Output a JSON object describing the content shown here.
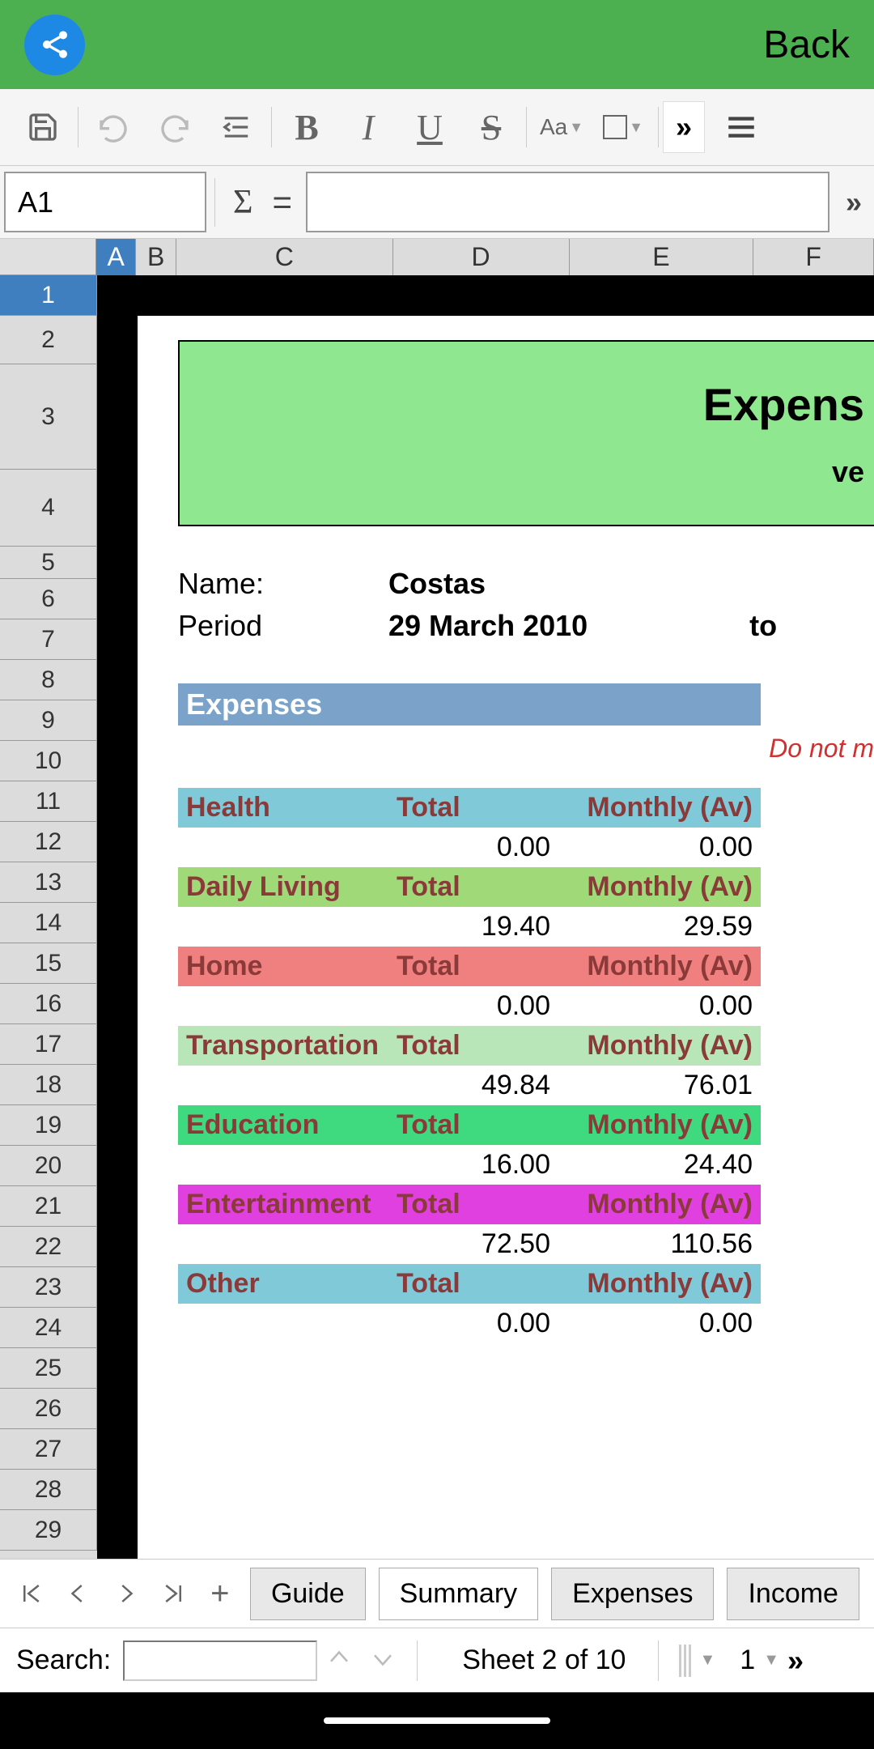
{
  "header": {
    "back_label": "Back"
  },
  "toolbar": {
    "bold": "B",
    "italic": "I",
    "underline": "U",
    "strike": "S",
    "aa": "Aa",
    "more": "»"
  },
  "formula_bar": {
    "cell_ref": "A1",
    "sigma": "Σ",
    "equals": "=",
    "more": "»"
  },
  "columns": [
    "A",
    "B",
    "C",
    "D",
    "E",
    "F"
  ],
  "rows": [
    "1",
    "2",
    "3",
    "4",
    "5",
    "6",
    "7",
    "8",
    "9",
    "10",
    "11",
    "12",
    "13",
    "14",
    "15",
    "16",
    "17",
    "18",
    "19",
    "20",
    "21",
    "22",
    "23",
    "24",
    "25",
    "26",
    "27",
    "28",
    "29"
  ],
  "doc": {
    "title_main": "Expens",
    "title_sub": "ve",
    "name_label": "Name:",
    "name_value": "Costas",
    "period_label": "Period",
    "period_value": "29 March 2010",
    "to_label": "to",
    "expenses_header": "Expenses",
    "warning": "Do not m",
    "total_label": "Total",
    "monthly_label": "Monthly (Av)",
    "categories": [
      {
        "name": "Health",
        "bg": "bg-health",
        "total": "0.00",
        "monthly": "0.00"
      },
      {
        "name": "Daily Living",
        "bg": "bg-daily",
        "total": "19.40",
        "monthly": "29.59"
      },
      {
        "name": "Home",
        "bg": "bg-home",
        "total": "0.00",
        "monthly": "0.00"
      },
      {
        "name": "Transportation",
        "bg": "bg-transport",
        "total": "49.84",
        "monthly": "76.01"
      },
      {
        "name": "Education",
        "bg": "bg-education",
        "total": "16.00",
        "monthly": "24.40"
      },
      {
        "name": "Entertainment",
        "bg": "bg-entertainment",
        "total": "72.50",
        "monthly": "110.56"
      },
      {
        "name": "Other",
        "bg": "bg-other",
        "total": "0.00",
        "monthly": "0.00"
      }
    ]
  },
  "tabs": {
    "plus": "+",
    "items": [
      "Guide",
      "Summary",
      "Expenses",
      "Income"
    ]
  },
  "search": {
    "label": "Search:",
    "sheet_info": "Sheet 2 of 10",
    "page": "1",
    "more": "»"
  }
}
